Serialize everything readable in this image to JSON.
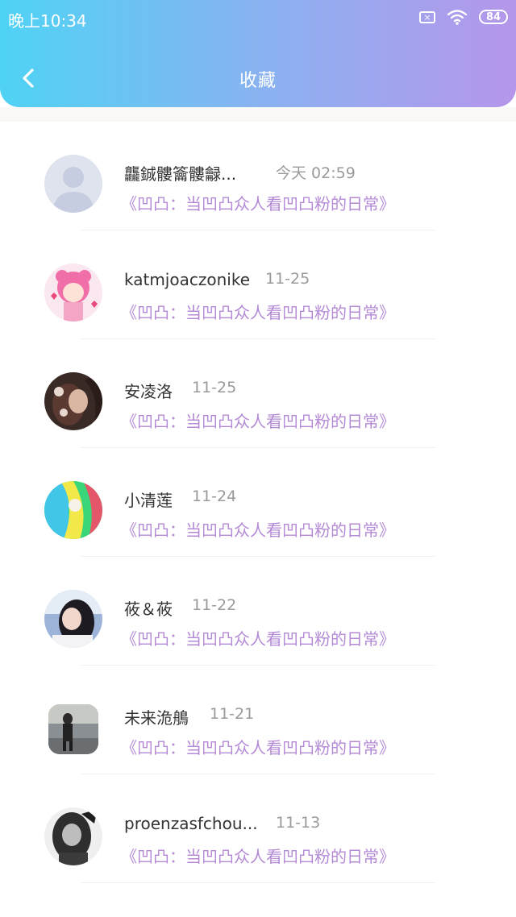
{
  "status": {
    "time": "晚上10:34",
    "battery": "84",
    "sim_icon": "sim-off-icon",
    "wifi_icon": "wifi-icon"
  },
  "header": {
    "title": "收藏",
    "back_icon": "back-arrow-icon"
  },
  "items": [
    {
      "name": "龘鋮髏籥髏龣...",
      "date": "今天 02:59",
      "collection": "《凹凸：当凹凸众人看凹凸粉的日常》",
      "avatar": "default-avatar"
    },
    {
      "name": "katmjoaczonike",
      "date": "11-25",
      "collection": "《凹凸：当凹凸众人看凹凸粉的日常》",
      "avatar": "anime-pink-avatar"
    },
    {
      "name": "安凌洛",
      "date": "11-25",
      "collection": "《凹凸：当凹凸众人看凹凸粉的日常》",
      "avatar": "dark-portrait-avatar"
    },
    {
      "name": "小清莲",
      "date": "11-24",
      "collection": "《凹凸：当凹凸众人看凹凸粉的日常》",
      "avatar": "colorful-avatar"
    },
    {
      "name": "莜＆莜",
      "date": "11-22",
      "collection": "《凹凸：当凹凸众人看凹凸粉的日常》",
      "avatar": "girl-photo-avatar"
    },
    {
      "name": "未来洈鵃",
      "date": "11-21",
      "collection": "《凹凸：当凹凸众人看凹凸粉的日常》",
      "avatar": "street-photo-avatar"
    },
    {
      "name": "proenzasfchou...",
      "date": "11-13",
      "collection": "《凹凸：当凹凸众人看凹凸粉的日常》",
      "avatar": "bw-portrait-avatar"
    }
  ],
  "colors": {
    "accent": "#b48ad6",
    "header_start": "#4fd3f5",
    "header_end": "#b596ea"
  }
}
